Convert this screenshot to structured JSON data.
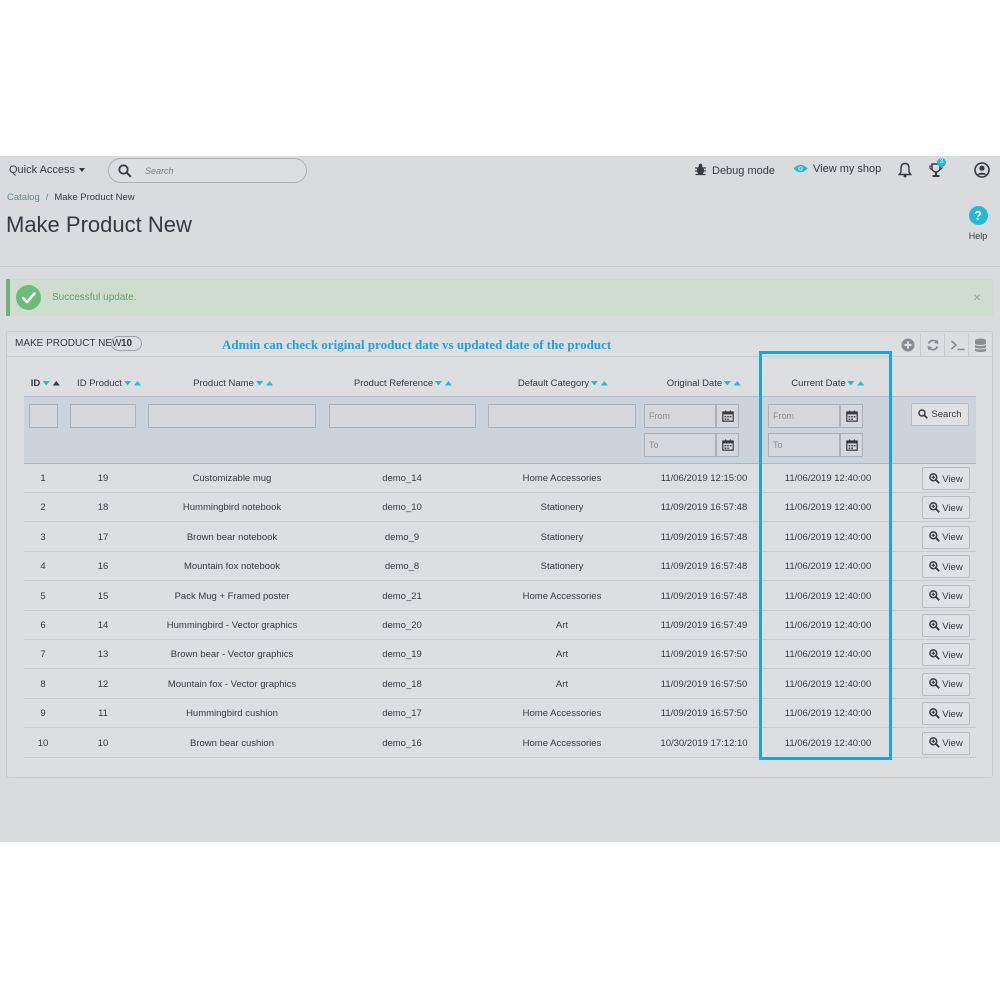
{
  "header": {
    "quick_access": "Quick Access",
    "search_placeholder": "Search",
    "debug_mode": "Debug mode",
    "view_shop": "View my shop",
    "notif_count": "3"
  },
  "breadcrumb": {
    "parent": "Catalog",
    "separator": "/",
    "current": "Make Product New"
  },
  "page_title": "Make Product New",
  "help_label": "Help",
  "alert": {
    "message": "Successful update.",
    "close": "×"
  },
  "panel": {
    "title": "MAKE PRODUCT NEW",
    "count": "10",
    "annotation": "Admin can check original product date vs updated date of the product"
  },
  "columns": [
    {
      "key": "id",
      "label": "ID"
    },
    {
      "key": "id_product",
      "label": "ID Product"
    },
    {
      "key": "name",
      "label": "Product Name"
    },
    {
      "key": "reference",
      "label": "Product Reference"
    },
    {
      "key": "category",
      "label": "Default Category"
    },
    {
      "key": "original_date",
      "label": "Original Date"
    },
    {
      "key": "current_date",
      "label": "Current Date"
    }
  ],
  "filters": {
    "from_placeholder": "From",
    "to_placeholder": "To",
    "search_label": "Search"
  },
  "view_label": "View",
  "colors": {
    "accent": "#25b9d7",
    "highlight": "#1da1e8",
    "success": "#6cbb79"
  },
  "rows": [
    {
      "id": "1",
      "id_product": "19",
      "name": "Customizable mug",
      "reference": "demo_14",
      "category": "Home Accessories",
      "original_date": "11/06/2019 12:15:00",
      "current_date": "11/06/2019 12:40:00"
    },
    {
      "id": "2",
      "id_product": "18",
      "name": "Hummingbird notebook",
      "reference": "demo_10",
      "category": "Stationery",
      "original_date": "11/09/2019 16:57:48",
      "current_date": "11/06/2019 12:40:00"
    },
    {
      "id": "3",
      "id_product": "17",
      "name": "Brown bear notebook",
      "reference": "demo_9",
      "category": "Stationery",
      "original_date": "11/09/2019 16:57:48",
      "current_date": "11/06/2019 12:40:00"
    },
    {
      "id": "4",
      "id_product": "16",
      "name": "Mountain fox notebook",
      "reference": "demo_8",
      "category": "Stationery",
      "original_date": "11/09/2019 16:57:48",
      "current_date": "11/06/2019 12:40:00"
    },
    {
      "id": "5",
      "id_product": "15",
      "name": "Pack Mug + Framed poster",
      "reference": "demo_21",
      "category": "Home Accessories",
      "original_date": "11/09/2019 16:57:48",
      "current_date": "11/06/2019 12:40:00"
    },
    {
      "id": "6",
      "id_product": "14",
      "name": "Hummingbird - Vector graphics",
      "reference": "demo_20",
      "category": "Art",
      "original_date": "11/09/2019 16:57:49",
      "current_date": "11/06/2019 12:40:00"
    },
    {
      "id": "7",
      "id_product": "13",
      "name": "Brown bear - Vector graphics",
      "reference": "demo_19",
      "category": "Art",
      "original_date": "11/09/2019 16:57:50",
      "current_date": "11/06/2019 12:40:00"
    },
    {
      "id": "8",
      "id_product": "12",
      "name": "Mountain fox - Vector graphics",
      "reference": "demo_18",
      "category": "Art",
      "original_date": "11/09/2019 16:57:50",
      "current_date": "11/06/2019 12:40:00"
    },
    {
      "id": "9",
      "id_product": "11",
      "name": "Hummingbird cushion",
      "reference": "demo_17",
      "category": "Home Accessories",
      "original_date": "11/09/2019 16:57:50",
      "current_date": "11/06/2019 12:40:00"
    },
    {
      "id": "10",
      "id_product": "10",
      "name": "Brown bear cushion",
      "reference": "demo_16",
      "category": "Home Accessories",
      "original_date": "10/30/2019 17:12:10",
      "current_date": "11/06/2019 12:40:00"
    }
  ]
}
